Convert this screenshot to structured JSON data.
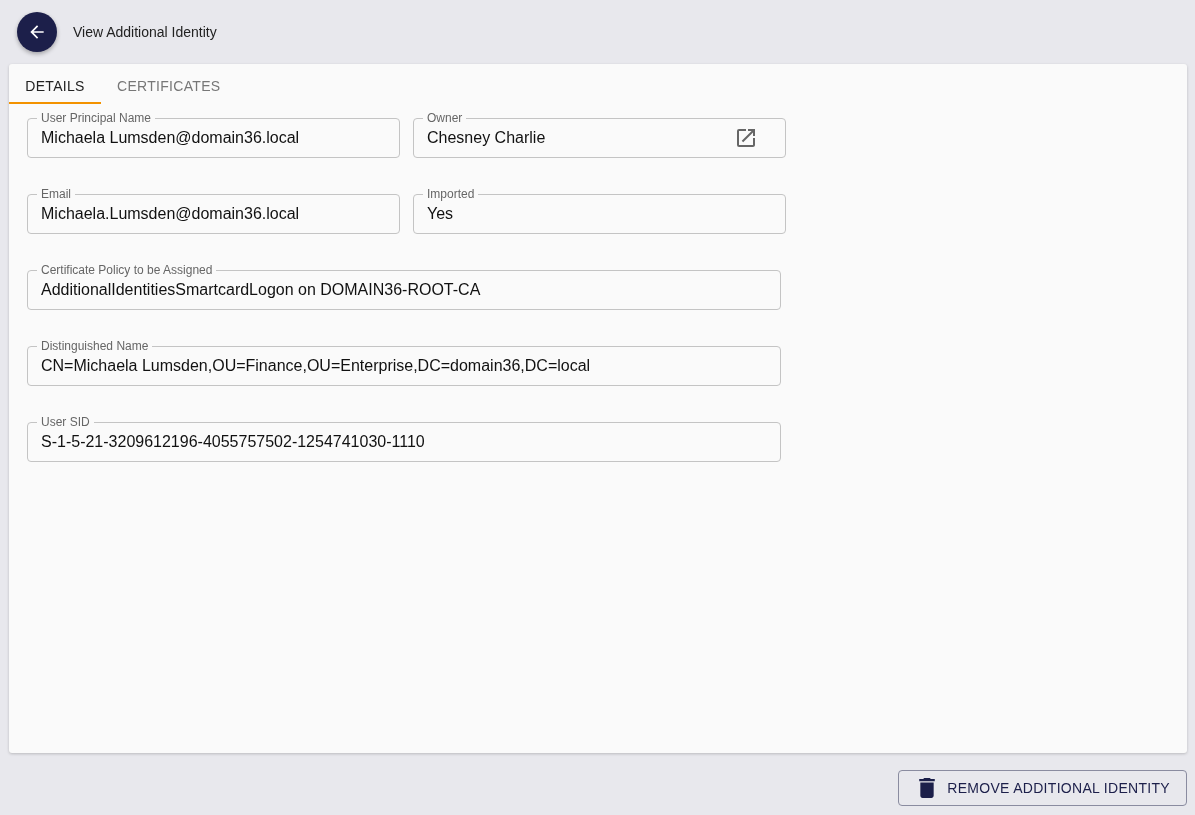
{
  "header": {
    "title": "View Additional Identity"
  },
  "tabs": [
    {
      "label": "DETAILS",
      "selected": true
    },
    {
      "label": "CERTIFICATES",
      "selected": false
    }
  ],
  "field_rows": [
    [
      {
        "label": "User Principal Name",
        "value": "Michaela Lumsden@domain36.local",
        "link": false
      },
      {
        "label": "Owner",
        "value": "Chesney Charlie",
        "link": true
      }
    ],
    [
      {
        "label": "Email",
        "value": "Michaela.Lumsden@domain36.local",
        "link": false
      },
      {
        "label": "Imported",
        "value": "Yes",
        "link": false
      }
    ],
    [
      {
        "label": "Certificate Policy to be Assigned",
        "value": "AdditionalIdentitiesSmartcardLogon on DOMAIN36-ROOT-CA",
        "link": false
      }
    ],
    [
      {
        "label": "Distinguished Name",
        "value": "CN=Michaela Lumsden,OU=Finance,OU=Enterprise,DC=domain36,DC=local",
        "link": false
      }
    ],
    [
      {
        "label": "User SID",
        "value": "S-1-5-21-3209612196-4055757502-1254741030-1110",
        "link": false
      }
    ]
  ],
  "footer": {
    "button": "REMOVE ADDITIONAL IDENTITY"
  }
}
